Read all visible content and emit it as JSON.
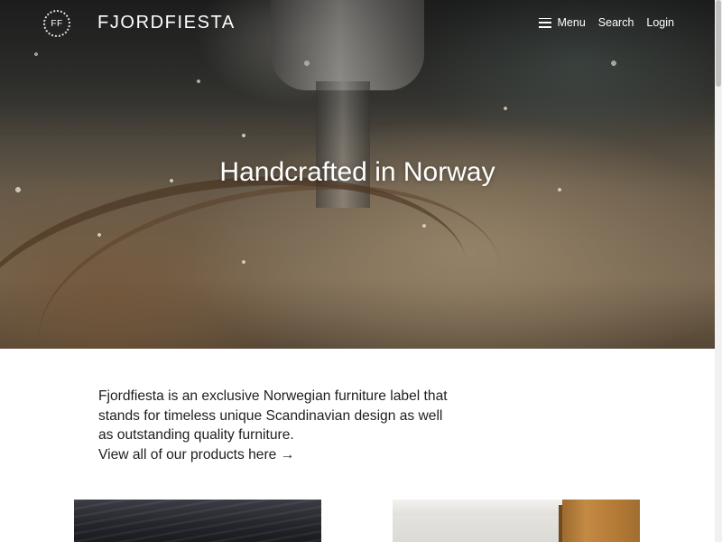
{
  "header": {
    "logo_initials": "FF",
    "brand": "FJORDFIESTA",
    "nav": {
      "menu_label": "Menu",
      "search_label": "Search",
      "login_label": "Login"
    }
  },
  "hero": {
    "title": "Handcrafted in Norway"
  },
  "intro": {
    "text": "Fjordfiesta is an exclusive Norwegian furniture label that stands for timeless unique Scandinavian design as well as outstanding quality furniture.",
    "link_label": "View all of our products here →"
  },
  "colors": {
    "text": "#1e1e1e",
    "header_text": "#ffffff",
    "background": "#ffffff"
  }
}
